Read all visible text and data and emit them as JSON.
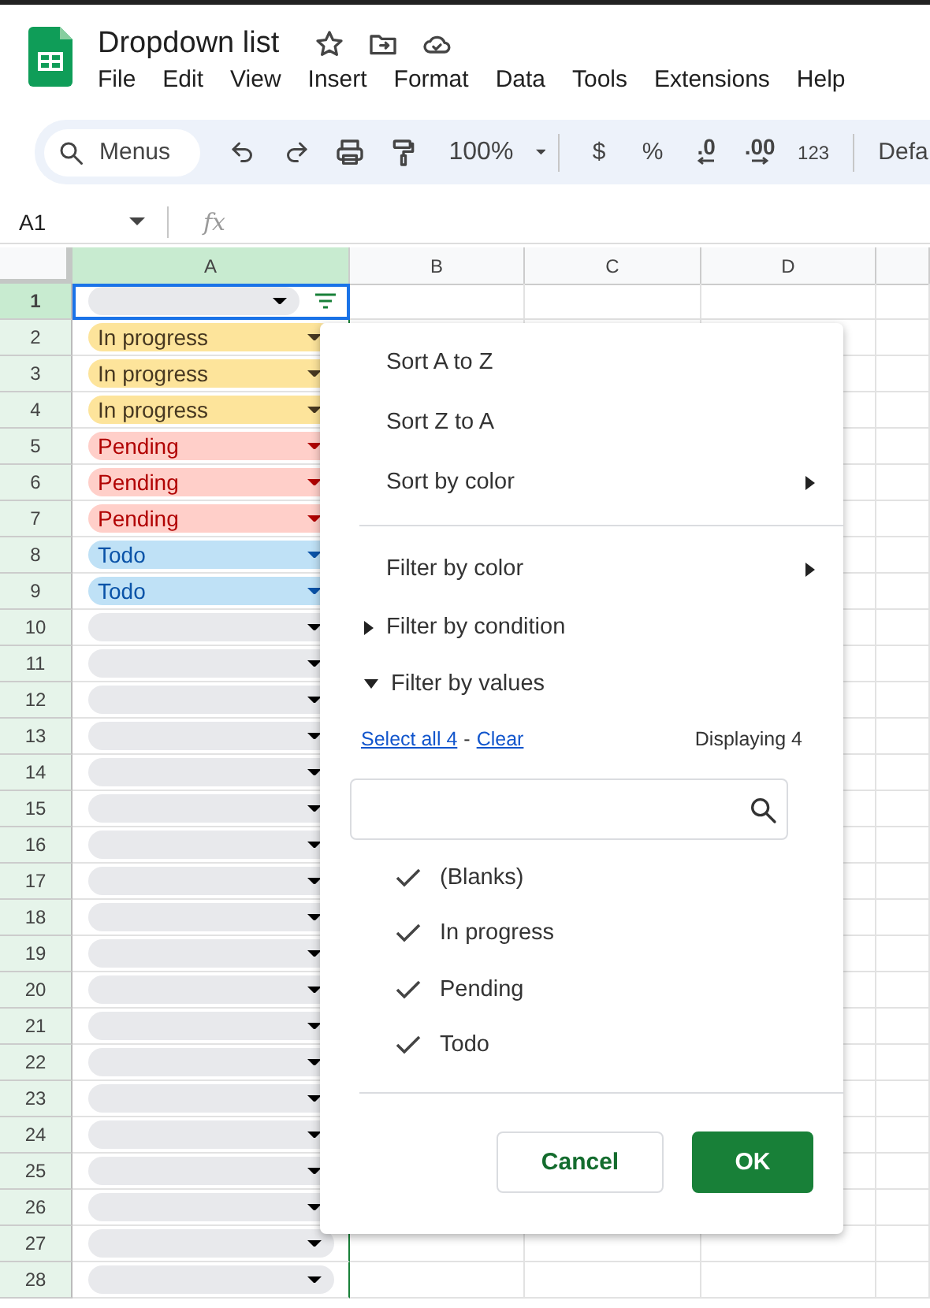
{
  "header": {
    "title": "Dropdown list",
    "menus": [
      "File",
      "Edit",
      "View",
      "Insert",
      "Format",
      "Data",
      "Tools",
      "Extensions",
      "Help"
    ]
  },
  "toolbar": {
    "search_placeholder": "Menus",
    "zoom": "100%",
    "currency": "$",
    "percent": "%",
    "decrease_decimals": ".0",
    "increase_decimals": ".00",
    "number_format": "123",
    "font": "Defa"
  },
  "formula_bar": {
    "cell_ref": "A1",
    "fx": "fx"
  },
  "columns": [
    {
      "label": "A",
      "selected": true
    },
    {
      "label": "B",
      "selected": false
    },
    {
      "label": "C",
      "selected": false
    },
    {
      "label": "D",
      "selected": false
    }
  ],
  "rows": [
    {
      "number": "1",
      "kind": "blank",
      "selected": true
    },
    {
      "number": "2",
      "kind": "progress",
      "value": "In progress",
      "selected": false
    },
    {
      "number": "3",
      "kind": "progress",
      "value": "In progress",
      "selected": false
    },
    {
      "number": "4",
      "kind": "progress",
      "value": "In progress",
      "selected": false
    },
    {
      "number": "5",
      "kind": "pending",
      "value": "Pending",
      "selected": false
    },
    {
      "number": "6",
      "kind": "pending",
      "value": "Pending",
      "selected": false
    },
    {
      "number": "7",
      "kind": "pending",
      "value": "Pending",
      "selected": false
    },
    {
      "number": "8",
      "kind": "todo",
      "value": "Todo",
      "selected": false
    },
    {
      "number": "9",
      "kind": "todo",
      "value": "Todo",
      "selected": false
    },
    {
      "number": "10",
      "kind": "blank",
      "selected": false
    },
    {
      "number": "11",
      "kind": "blank",
      "selected": false
    },
    {
      "number": "12",
      "kind": "blank",
      "selected": false
    },
    {
      "number": "13",
      "kind": "blank",
      "selected": false
    },
    {
      "number": "14",
      "kind": "blank",
      "selected": false
    },
    {
      "number": "15",
      "kind": "blank",
      "selected": false
    },
    {
      "number": "16",
      "kind": "blank",
      "selected": false
    },
    {
      "number": "17",
      "kind": "blank",
      "selected": false
    },
    {
      "number": "18",
      "kind": "blank",
      "selected": false
    },
    {
      "number": "19",
      "kind": "blank",
      "selected": false
    },
    {
      "number": "20",
      "kind": "blank",
      "selected": false
    },
    {
      "number": "21",
      "kind": "blank",
      "selected": false
    },
    {
      "number": "22",
      "kind": "blank",
      "selected": false
    },
    {
      "number": "23",
      "kind": "blank",
      "selected": false
    },
    {
      "number": "24",
      "kind": "blank",
      "selected": false
    },
    {
      "number": "25",
      "kind": "blank",
      "selected": false
    },
    {
      "number": "26",
      "kind": "blank",
      "selected": false
    },
    {
      "number": "27",
      "kind": "blank",
      "selected": false
    },
    {
      "number": "28",
      "kind": "blank",
      "selected": false
    }
  ],
  "filter_menu": {
    "sort_items": [
      {
        "label": "Sort A to Z",
        "submenu": false
      },
      {
        "label": "Sort Z to A",
        "submenu": false
      },
      {
        "label": "Sort by color",
        "submenu": true
      }
    ],
    "filter_items": [
      {
        "label": "Filter by color",
        "kind": "submenu"
      },
      {
        "label": "Filter by condition",
        "kind": "section",
        "expanded": false
      },
      {
        "label": "Filter by values",
        "kind": "section",
        "expanded": true
      }
    ],
    "select_all": "Select all 4",
    "separator": "-",
    "clear": "Clear",
    "displaying": "Displaying 4",
    "values": [
      {
        "label": "(Blanks)",
        "checked": true
      },
      {
        "label": "In progress",
        "checked": true
      },
      {
        "label": "Pending",
        "checked": true
      },
      {
        "label": "Todo",
        "checked": true
      }
    ],
    "cancel": "Cancel",
    "ok": "OK"
  }
}
